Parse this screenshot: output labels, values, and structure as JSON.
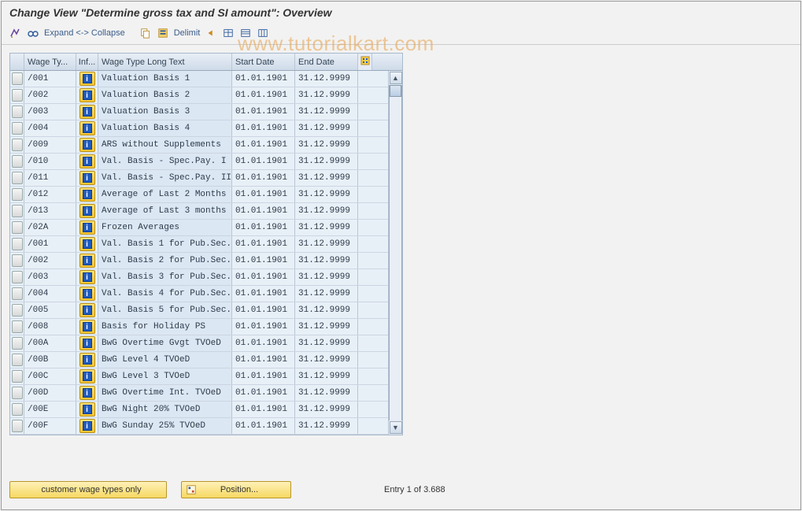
{
  "title": "Change View \"Determine gross tax and SI amount\": Overview",
  "toolbar": {
    "expand_label": "Expand <-> Collapse",
    "delimit_label": "Delimit"
  },
  "columns": {
    "wage_type": "Wage Ty...",
    "inf": "Inf...",
    "long_text": "Wage Type Long Text",
    "start_date": "Start Date",
    "end_date": "End Date"
  },
  "info_glyph": "i",
  "rows": [
    {
      "wt": "/001",
      "long": "Valuation Basis 1",
      "sd": "01.01.1901",
      "ed": "31.12.9999"
    },
    {
      "wt": "/002",
      "long": "Valuation Basis 2",
      "sd": "01.01.1901",
      "ed": "31.12.9999"
    },
    {
      "wt": "/003",
      "long": "Valuation Basis 3",
      "sd": "01.01.1901",
      "ed": "31.12.9999"
    },
    {
      "wt": "/004",
      "long": "Valuation Basis 4",
      "sd": "01.01.1901",
      "ed": "31.12.9999"
    },
    {
      "wt": "/009",
      "long": "ARS without Supplements",
      "sd": "01.01.1901",
      "ed": "31.12.9999"
    },
    {
      "wt": "/010",
      "long": "Val. Basis - Spec.Pay. I",
      "sd": "01.01.1901",
      "ed": "31.12.9999"
    },
    {
      "wt": "/011",
      "long": "Val. Basis - Spec.Pay. II",
      "sd": "01.01.1901",
      "ed": "31.12.9999"
    },
    {
      "wt": "/012",
      "long": "Average of Last 2 Months",
      "sd": "01.01.1901",
      "ed": "31.12.9999"
    },
    {
      "wt": "/013",
      "long": "Average of Last 3 months",
      "sd": "01.01.1901",
      "ed": "31.12.9999"
    },
    {
      "wt": "/02A",
      "long": "Frozen Averages",
      "sd": "01.01.1901",
      "ed": "31.12.9999"
    },
    {
      "wt": "/001",
      "long": "Val. Basis 1 for Pub.Sec.",
      "sd": "01.01.1901",
      "ed": "31.12.9999"
    },
    {
      "wt": "/002",
      "long": "Val. Basis 2 for Pub.Sec.",
      "sd": "01.01.1901",
      "ed": "31.12.9999"
    },
    {
      "wt": "/003",
      "long": "Val. Basis 3 for Pub.Sec.",
      "sd": "01.01.1901",
      "ed": "31.12.9999"
    },
    {
      "wt": "/004",
      "long": "Val. Basis 4 for Pub.Sec.",
      "sd": "01.01.1901",
      "ed": "31.12.9999"
    },
    {
      "wt": "/005",
      "long": "Val. Basis 5 for Pub.Sec.",
      "sd": "01.01.1901",
      "ed": "31.12.9999"
    },
    {
      "wt": "/008",
      "long": "Basis for Holiday PS",
      "sd": "01.01.1901",
      "ed": "31.12.9999"
    },
    {
      "wt": "/00A",
      "long": "BwG Overtime Gvgt TVOeD",
      "sd": "01.01.1901",
      "ed": "31.12.9999"
    },
    {
      "wt": "/00B",
      "long": "BwG Level 4 TVOeD",
      "sd": "01.01.1901",
      "ed": "31.12.9999"
    },
    {
      "wt": "/00C",
      "long": "BwG Level 3 TVOeD",
      "sd": "01.01.1901",
      "ed": "31.12.9999"
    },
    {
      "wt": "/00D",
      "long": "BwG Overtime Int. TVOeD",
      "sd": "01.01.1901",
      "ed": "31.12.9999"
    },
    {
      "wt": "/00E",
      "long": "BwG Night 20% TVOeD",
      "sd": "01.01.1901",
      "ed": "31.12.9999"
    },
    {
      "wt": "/00F",
      "long": "BwG Sunday 25% TVOeD",
      "sd": "01.01.1901",
      "ed": "31.12.9999"
    }
  ],
  "footer": {
    "customer_btn": "customer wage types only",
    "position_btn": "Position...",
    "entry_status": "Entry 1 of 3.688"
  },
  "watermark": "www.tutorialkart.com"
}
